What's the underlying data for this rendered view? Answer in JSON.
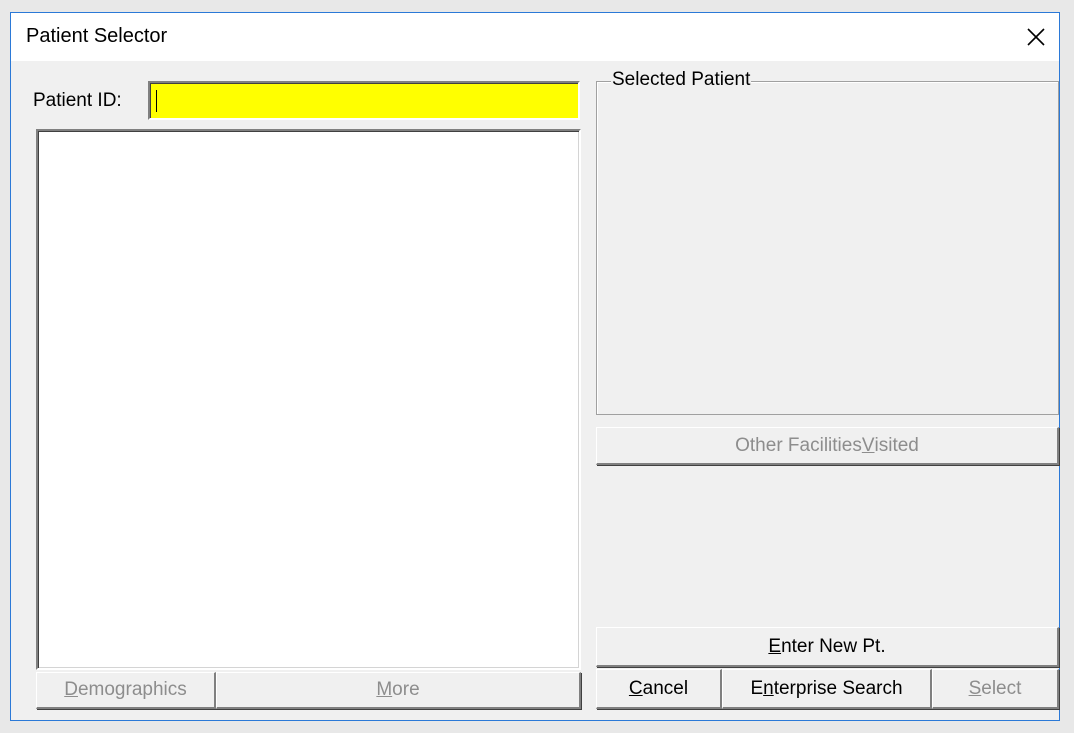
{
  "window": {
    "title": "Patient Selector",
    "close_glyph": "✕",
    "close_icon": "close-icon"
  },
  "patient_id": {
    "label": "Patient ID:",
    "value": "",
    "field_color": "#ffff00"
  },
  "selected_patient": {
    "label": "Selected Patient"
  },
  "buttons": {
    "other_facilities": {
      "pre": "Other Facilities ",
      "key": "V",
      "post": "isited",
      "enabled": false
    },
    "enter_new_pt": {
      "pre": "",
      "key": "E",
      "post": "nter New Pt.",
      "enabled": true
    },
    "demographics": {
      "pre": "",
      "key": "D",
      "post": "emographics",
      "enabled": false
    },
    "more": {
      "pre": "",
      "key": "M",
      "post": "ore",
      "enabled": false
    },
    "cancel": {
      "pre": "",
      "key": "C",
      "post": "ancel",
      "enabled": true
    },
    "enterprise_search": {
      "pre": "E",
      "key": "n",
      "post": "terprise Search",
      "enabled": true
    },
    "select": {
      "pre": "",
      "key": "S",
      "post": "elect",
      "enabled": false
    }
  }
}
